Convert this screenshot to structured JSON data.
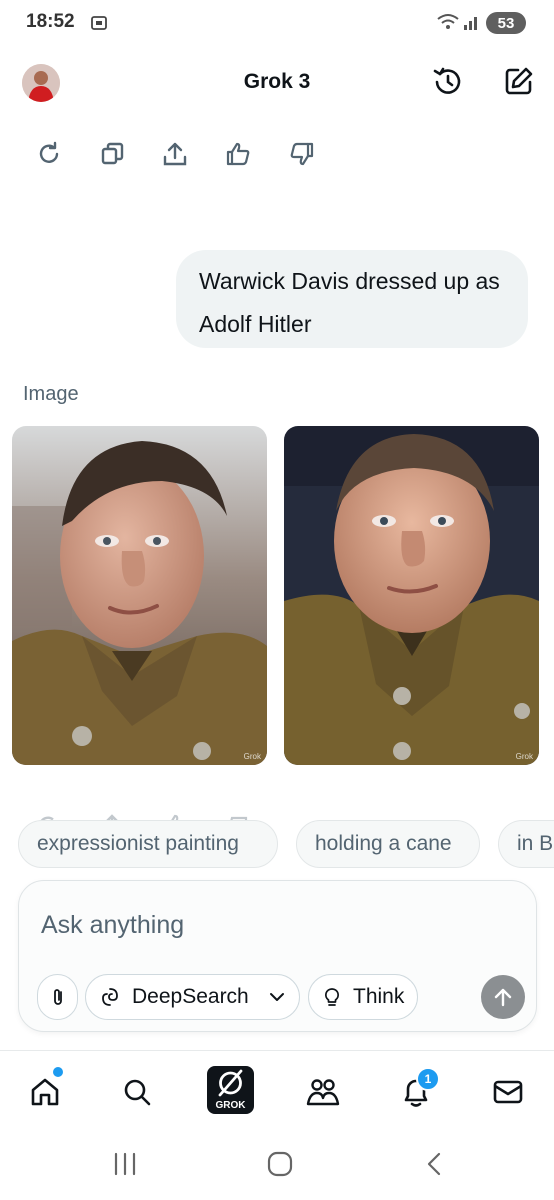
{
  "status": {
    "time": "18:52",
    "battery": "53"
  },
  "header": {
    "title": "Grok 3"
  },
  "conversation": {
    "user_message": "Warwick Davis dressed up as Adolf Hitler",
    "image_label": "Image",
    "images": [
      {
        "watermark": "Grok"
      },
      {
        "watermark": "Grok"
      }
    ]
  },
  "suggestions": [
    "expressionist painting",
    "holding a cane",
    "in B"
  ],
  "composer": {
    "placeholder": "Ask anything",
    "deepsearch_label": "DeepSearch",
    "think_label": "Think"
  },
  "bottom_nav": {
    "grok_label": "GROK",
    "notification_count": "1"
  },
  "colors": {
    "accent": "#1d9bf0",
    "text_primary": "#0f1419",
    "text_secondary": "#536471"
  }
}
